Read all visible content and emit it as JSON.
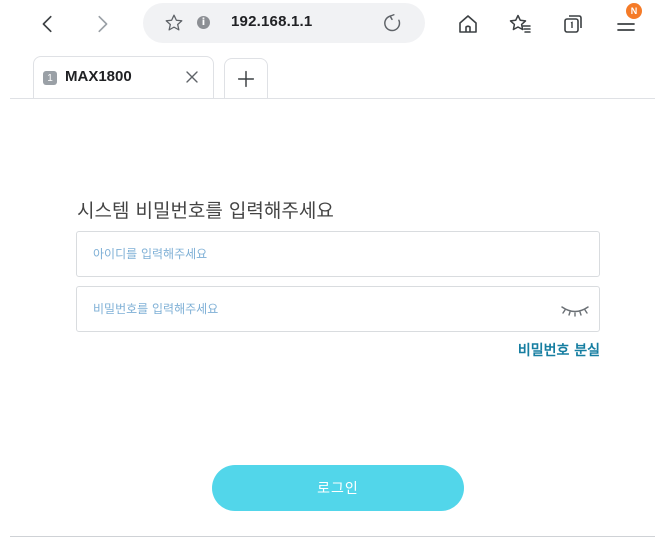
{
  "browser": {
    "url": "192.168.1.1",
    "info_glyph": "i",
    "notification_badge": "N",
    "tab": {
      "number": "1",
      "title": "MAX1800"
    },
    "accent_badge_color": "#f57b28",
    "icons": [
      "back-icon",
      "forward-icon",
      "star-icon",
      "info-icon",
      "reload-icon",
      "home-icon",
      "favorites-icon",
      "tabs-icon",
      "menu-icon",
      "close-icon",
      "plus-icon"
    ]
  },
  "login": {
    "heading": "시스템 비밀번호를 입력해주세요",
    "id_placeholder": "아이디를 입력해주세요",
    "password_placeholder": "비밀번호를 입력해주세요",
    "forgot_password": "비밀번호 분실",
    "login_button": "로그인",
    "button_color": "#52d6ea",
    "link_color": "#167ea1"
  }
}
